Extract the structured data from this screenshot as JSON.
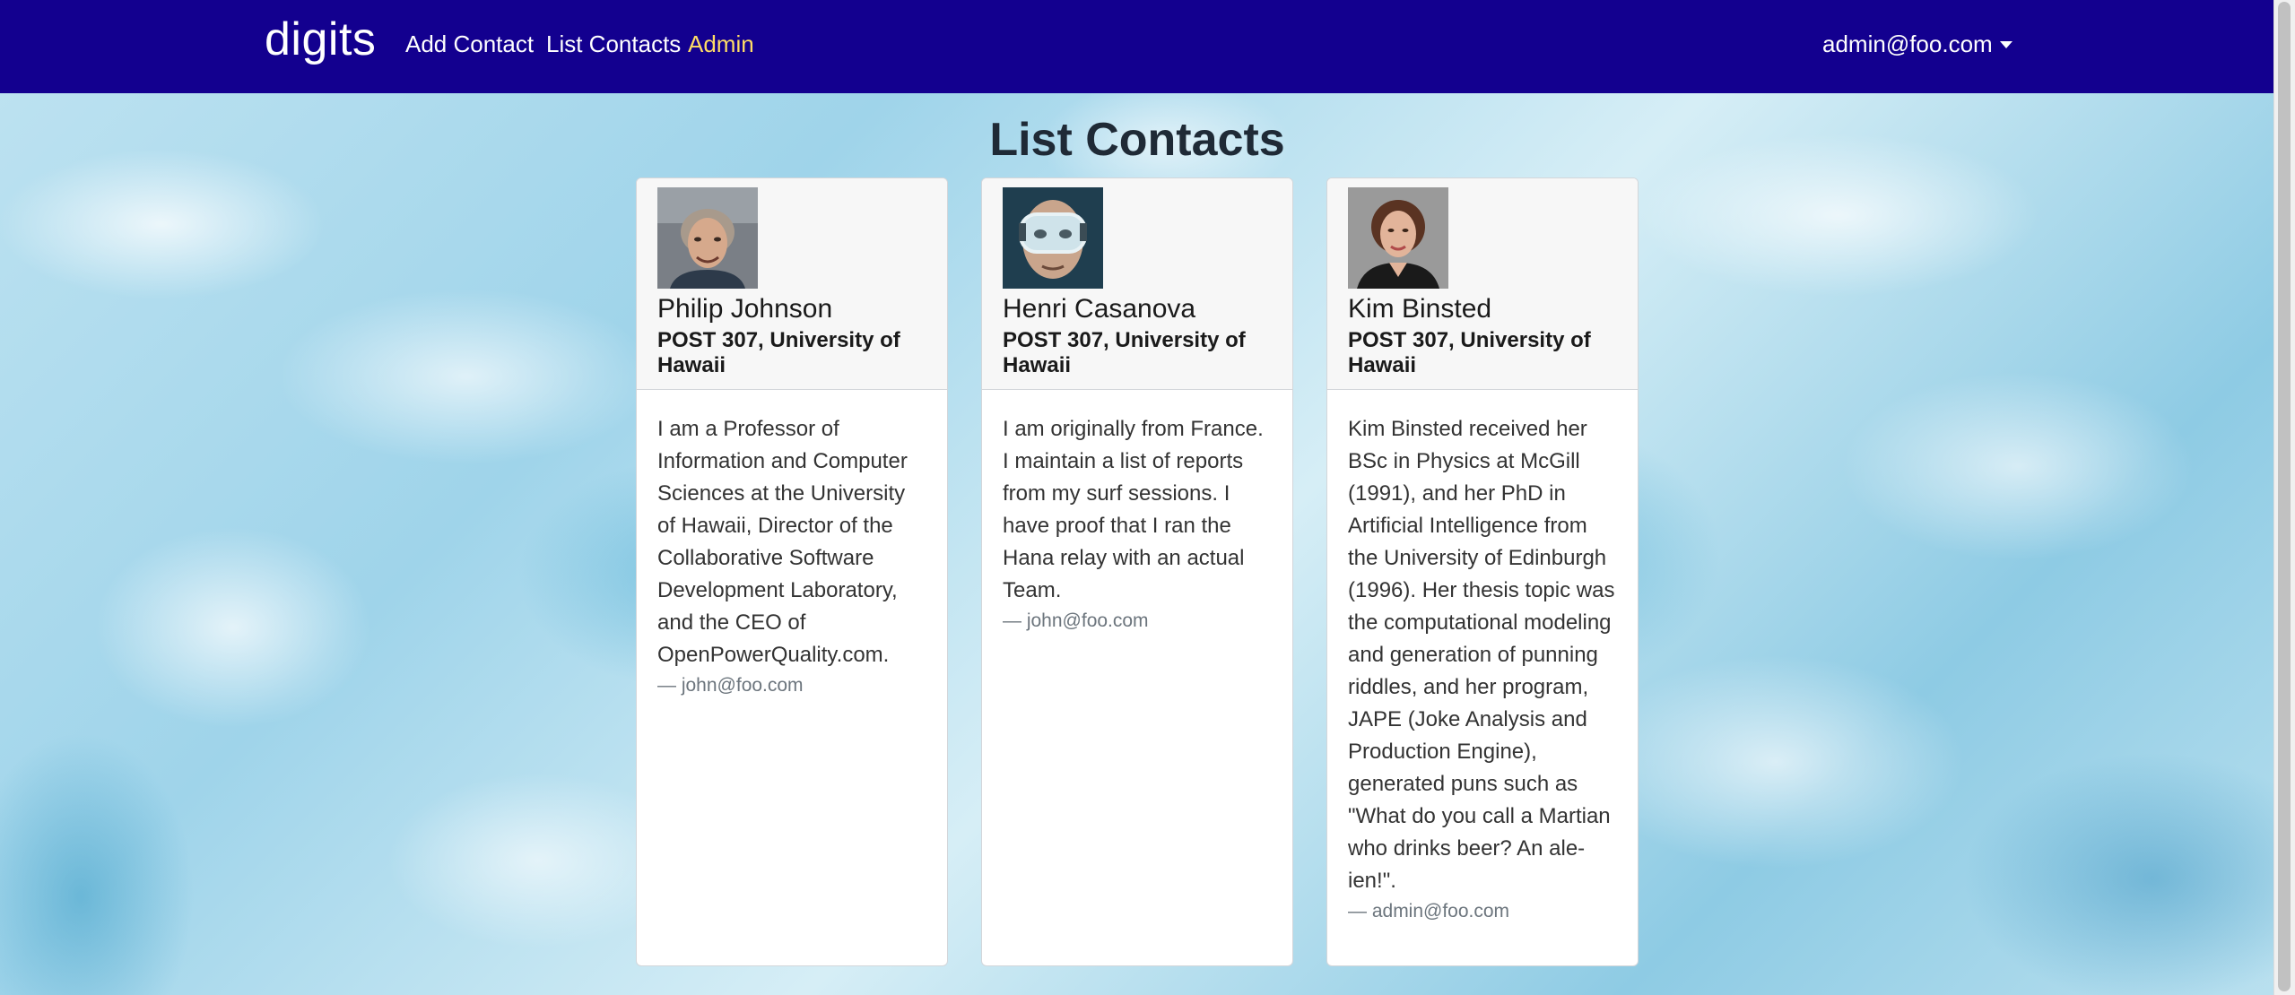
{
  "navbar": {
    "brand": "digits",
    "links": [
      "Add Contact",
      "List Contacts",
      "Admin"
    ],
    "user": "admin@foo.com",
    "background_color": "#13008f",
    "active_link_color": "#ffdd66"
  },
  "page": {
    "title": "List Contacts"
  },
  "contacts": [
    {
      "name": "Philip Johnson",
      "address": "POST 307, University of Hawaii",
      "description": "I am a Professor of Information and Computer Sciences at the University of Hawaii, Director of the Collaborative Software Development Laboratory, and the CEO of OpenPowerQuality.com.",
      "owner": "— john@foo.com"
    },
    {
      "name": "Henri Casanova",
      "address": "POST 307, University of Hawaii",
      "description": "I am originally from France. I maintain a list of reports from my surf sessions. I have proof that I ran the Hana relay with an actual Team.",
      "owner": "— john@foo.com"
    },
    {
      "name": "Kim Binsted",
      "address": "POST 307, University of Hawaii",
      "description": "Kim Binsted received her BSc in Physics at McGill (1991), and her PhD in Artificial Intelligence from the University of Edinburgh (1996). Her thesis topic was the computational modeling and generation of punning riddles, and her program, JAPE (Joke Analysis and Production Engine), generated puns such as \"What do you call a Martian who drinks beer? An ale-ien!\".",
      "owner": "— admin@foo.com"
    }
  ]
}
